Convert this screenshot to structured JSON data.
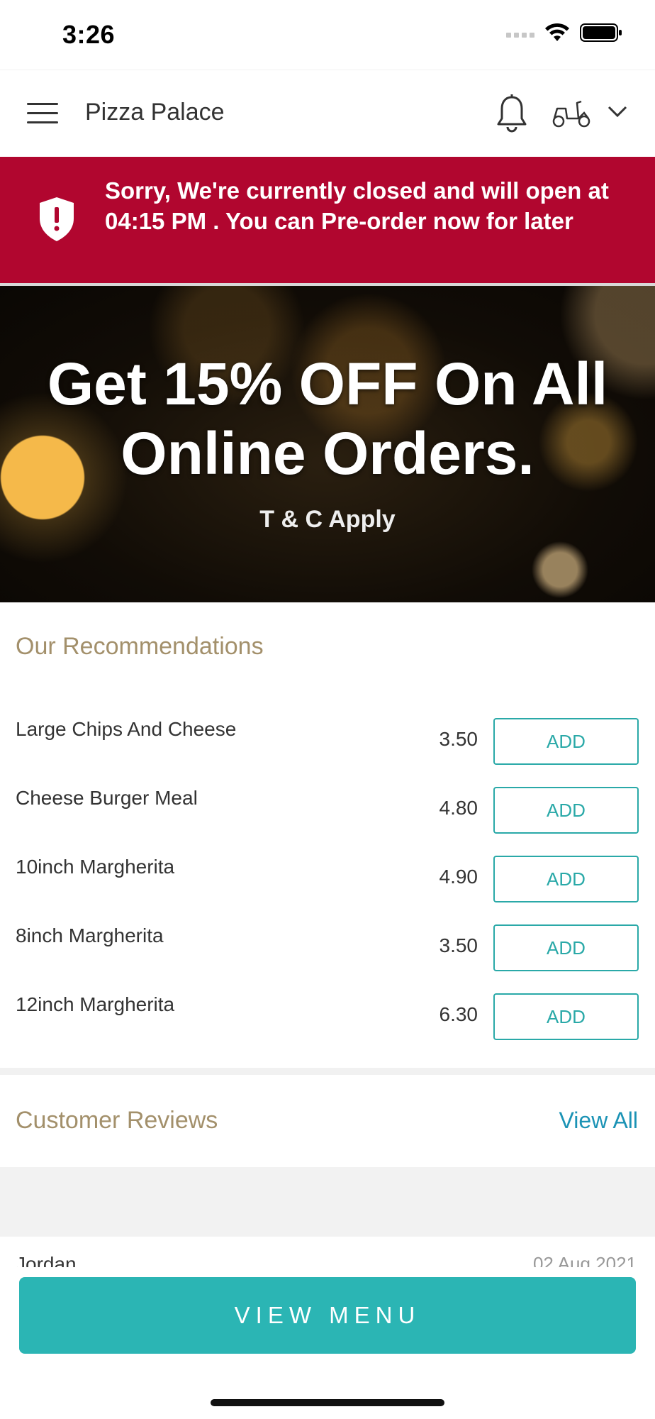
{
  "status_bar": {
    "time": "3:26"
  },
  "header": {
    "title": "Pizza Palace",
    "menu_icon": "hamburger-icon",
    "notification_icon": "bell-icon",
    "order_type_icon": "scooter-icon",
    "dropdown_icon": "chevron-down-icon"
  },
  "closed_banner": {
    "icon": "shield-alert-icon",
    "message": "Sorry, We're currently closed and will open at 04:15 PM . You can Pre-order now for later",
    "background": "#b1062f"
  },
  "promo": {
    "line1": "Get 15% OFF On All",
    "line2": "Online Orders.",
    "terms": "T & C Apply"
  },
  "recommendations": {
    "title": "Our Recommendations",
    "items": [
      {
        "name": "Large Chips And Cheese",
        "price": "3.50",
        "button": "ADD"
      },
      {
        "name": "Cheese Burger Meal",
        "price": "4.80",
        "button": "ADD"
      },
      {
        "name": "10inch Margherita",
        "price": "4.90",
        "button": "ADD"
      },
      {
        "name": "8inch Margherita",
        "price": "3.50",
        "button": "ADD"
      },
      {
        "name": "12inch Margherita",
        "price": "6.30",
        "button": "ADD"
      }
    ]
  },
  "reviews": {
    "title": "Customer Reviews",
    "view_all": "View All",
    "first": {
      "name": "Jordan",
      "date": "02 Aug 2021"
    }
  },
  "footer": {
    "view_menu": "VIEW MENU"
  },
  "colors": {
    "accent": "#2bb5b4",
    "section_title": "#a3906b",
    "link": "#1b93b5"
  }
}
